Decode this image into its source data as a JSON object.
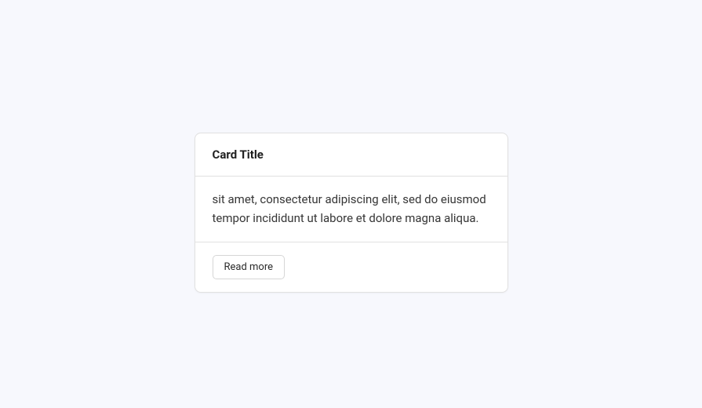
{
  "card": {
    "title": "Card Title",
    "body": "sit amet, consectetur adipiscing elit, sed do eiusmod tempor incididunt ut labore et dolore magna aliqua.",
    "button_label": "Read more"
  }
}
